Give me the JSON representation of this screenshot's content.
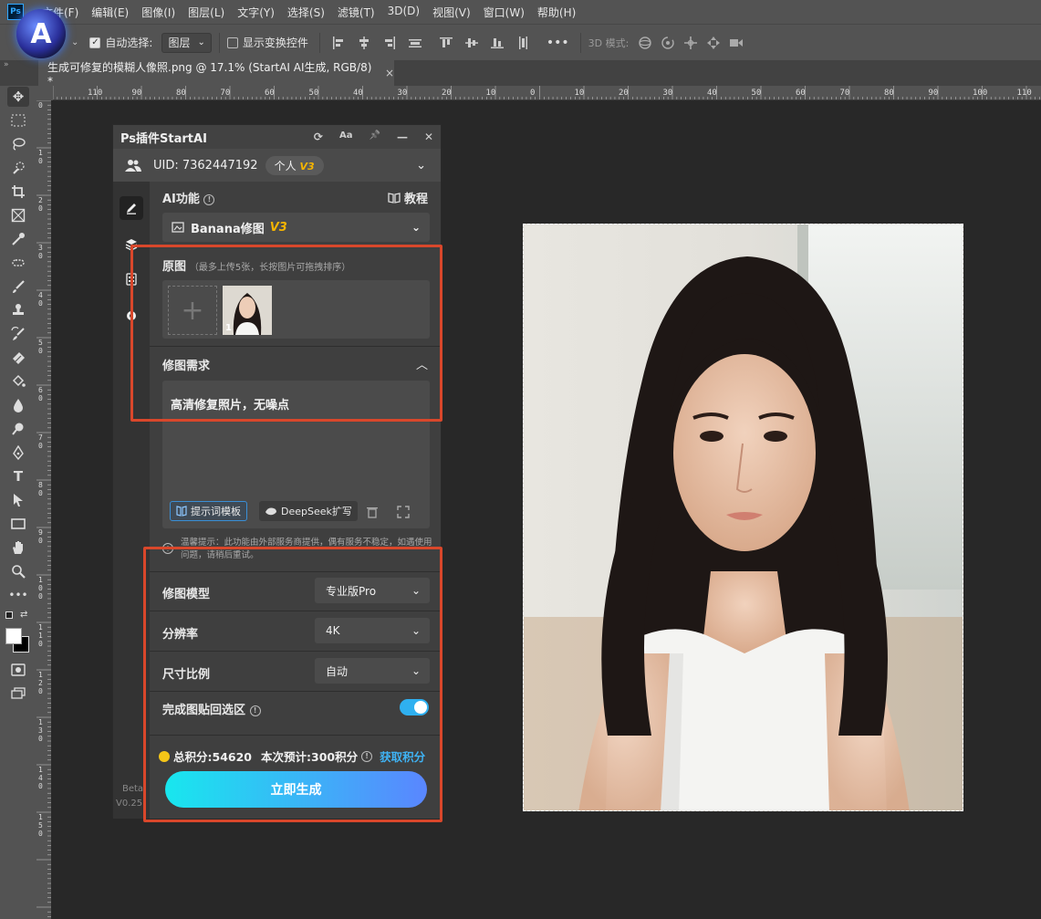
{
  "menu": {
    "app_icon": "Ps",
    "items": [
      "文件(F)",
      "编辑(E)",
      "图像(I)",
      "图层(L)",
      "文字(Y)",
      "选择(S)",
      "滤镜(T)",
      "3D(D)",
      "视图(V)",
      "窗口(W)",
      "帮助(H)"
    ]
  },
  "logo": {
    "letter": "A"
  },
  "options": {
    "auto_select_label": "自动选择:",
    "auto_select_checked": true,
    "auto_select_value": "图层",
    "show_transform_label": "显示变换控件",
    "show_transform_checked": false,
    "more": "•••",
    "mode_3d": "3D 模式:"
  },
  "tab": {
    "title": "生成可修复的模糊人像照.png @ 17.1% (StartAI AI生成, RGB/8) *",
    "close": "×"
  },
  "ruler": {
    "h_labels": [
      "110",
      "90",
      "80",
      "70",
      "60",
      "50",
      "40",
      "30",
      "20",
      "10",
      "0",
      "10",
      "20",
      "30",
      "40",
      "50",
      "60",
      "70",
      "80",
      "90",
      "100",
      "110"
    ],
    "v_labels": [
      "0",
      "1\n0",
      "2\n0",
      "3\n0",
      "4\n0",
      "5\n0",
      "6\n0",
      "7\n0",
      "8\n0",
      "9\n0",
      "1\n0\n0",
      "1\n1\n0",
      "1\n2\n0",
      "1\n3\n0",
      "1\n4\n0",
      "1\n5\n0"
    ]
  },
  "panel": {
    "title": "Ps插件StartAI",
    "controls": [
      "⟳",
      "Aa",
      "📌",
      "—",
      "✕"
    ],
    "uid_label": "UID: 7362447192",
    "plan": "个人",
    "plan_badge": "V3",
    "ai_func_label": "AI功能",
    "tutorial": "教程",
    "func_name": "Banana修图",
    "func_badge": "V3",
    "source_label": "原图",
    "source_hint": "（最多上传5张，长按图片可拖拽排序）",
    "thumb_index": "1",
    "req_label": "修图需求",
    "req_text": "高清修复照片，无噪点",
    "template_btn": "提示词模板",
    "deepseek_btn": "DeepSeek扩写",
    "notice": "温馨提示：此功能由外部服务商提供，偶有服务不稳定，如遇使用问题，请稍后重试。",
    "model_label": "修图模型",
    "model_value": "专业版Pro",
    "res_label": "分辨率",
    "res_value": "4K",
    "ratio_label": "尺寸比例",
    "ratio_value": "自动",
    "paste_label": "完成图贴回选区",
    "paste_on": true,
    "points_total": "总积分:54620",
    "points_cost": "本次预计:300积分",
    "get_points": "获取积分",
    "generate": "立即生成",
    "beta": "Beta",
    "version": "V0.25."
  },
  "colors": {
    "accent": "#2fb0f0",
    "highlight": "#d9472b",
    "badge": "#f5b400"
  }
}
